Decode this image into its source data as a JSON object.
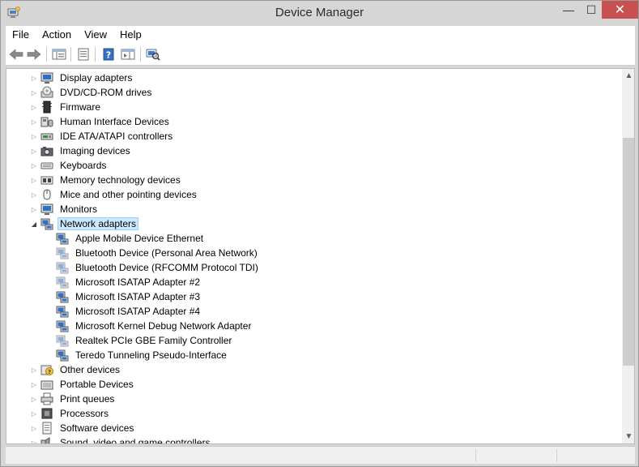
{
  "window": {
    "title": "Device Manager",
    "minimize_glyph": "—",
    "maximize_glyph": "☐",
    "close_glyph": "✕"
  },
  "menu": [
    "File",
    "Action",
    "View",
    "Help"
  ],
  "toolbar": {
    "buttons": [
      "back-icon",
      "forward-icon",
      "show-hide-console-tree-icon",
      "properties-icon",
      "help-icon",
      "action-pane-icon",
      "scan-hardware-icon"
    ]
  },
  "tree": {
    "categories": [
      {
        "label": "Display adapters",
        "icon": "display-adapter-icon",
        "expanded": false
      },
      {
        "label": "DVD/CD-ROM drives",
        "icon": "dvd-drive-icon",
        "expanded": false
      },
      {
        "label": "Firmware",
        "icon": "firmware-icon",
        "expanded": false
      },
      {
        "label": "Human Interface Devices",
        "icon": "hid-icon",
        "expanded": false
      },
      {
        "label": "IDE ATA/ATAPI controllers",
        "icon": "ide-controller-icon",
        "expanded": false
      },
      {
        "label": "Imaging devices",
        "icon": "imaging-device-icon",
        "expanded": false
      },
      {
        "label": "Keyboards",
        "icon": "keyboard-icon",
        "expanded": false
      },
      {
        "label": "Memory technology devices",
        "icon": "memory-device-icon",
        "expanded": false
      },
      {
        "label": "Mice and other pointing devices",
        "icon": "mouse-icon",
        "expanded": false
      },
      {
        "label": "Monitors",
        "icon": "monitor-icon",
        "expanded": false
      },
      {
        "label": "Network adapters",
        "icon": "network-adapter-icon",
        "expanded": true,
        "selected": true
      },
      {
        "label": "Other devices",
        "icon": "unknown-device-icon",
        "expanded": false
      },
      {
        "label": "Portable Devices",
        "icon": "portable-device-icon",
        "expanded": false
      },
      {
        "label": "Print queues",
        "icon": "printer-icon",
        "expanded": false
      },
      {
        "label": "Processors",
        "icon": "processor-icon",
        "expanded": false
      },
      {
        "label": "Software devices",
        "icon": "software-device-icon",
        "expanded": false
      },
      {
        "label": "Sound, video and game controllers",
        "icon": "sound-controller-icon",
        "expanded": false
      }
    ],
    "network_adapters": [
      {
        "label": "Apple Mobile Device Ethernet",
        "dimmed": false
      },
      {
        "label": "Bluetooth Device (Personal Area Network)",
        "dimmed": true
      },
      {
        "label": "Bluetooth Device (RFCOMM Protocol TDI)",
        "dimmed": true
      },
      {
        "label": "Microsoft ISATAP Adapter #2",
        "dimmed": true
      },
      {
        "label": "Microsoft ISATAP Adapter #3",
        "dimmed": false
      },
      {
        "label": "Microsoft ISATAP Adapter #4",
        "dimmed": false
      },
      {
        "label": "Microsoft Kernel Debug Network Adapter",
        "dimmed": false
      },
      {
        "label": "Realtek PCIe GBE Family Controller",
        "dimmed": true
      },
      {
        "label": "Teredo Tunneling Pseudo-Interface",
        "dimmed": false
      }
    ]
  },
  "colors": {
    "selection_bg": "#cce8ff",
    "selection_border": "#99d1ff",
    "close_button": "#c75050"
  }
}
